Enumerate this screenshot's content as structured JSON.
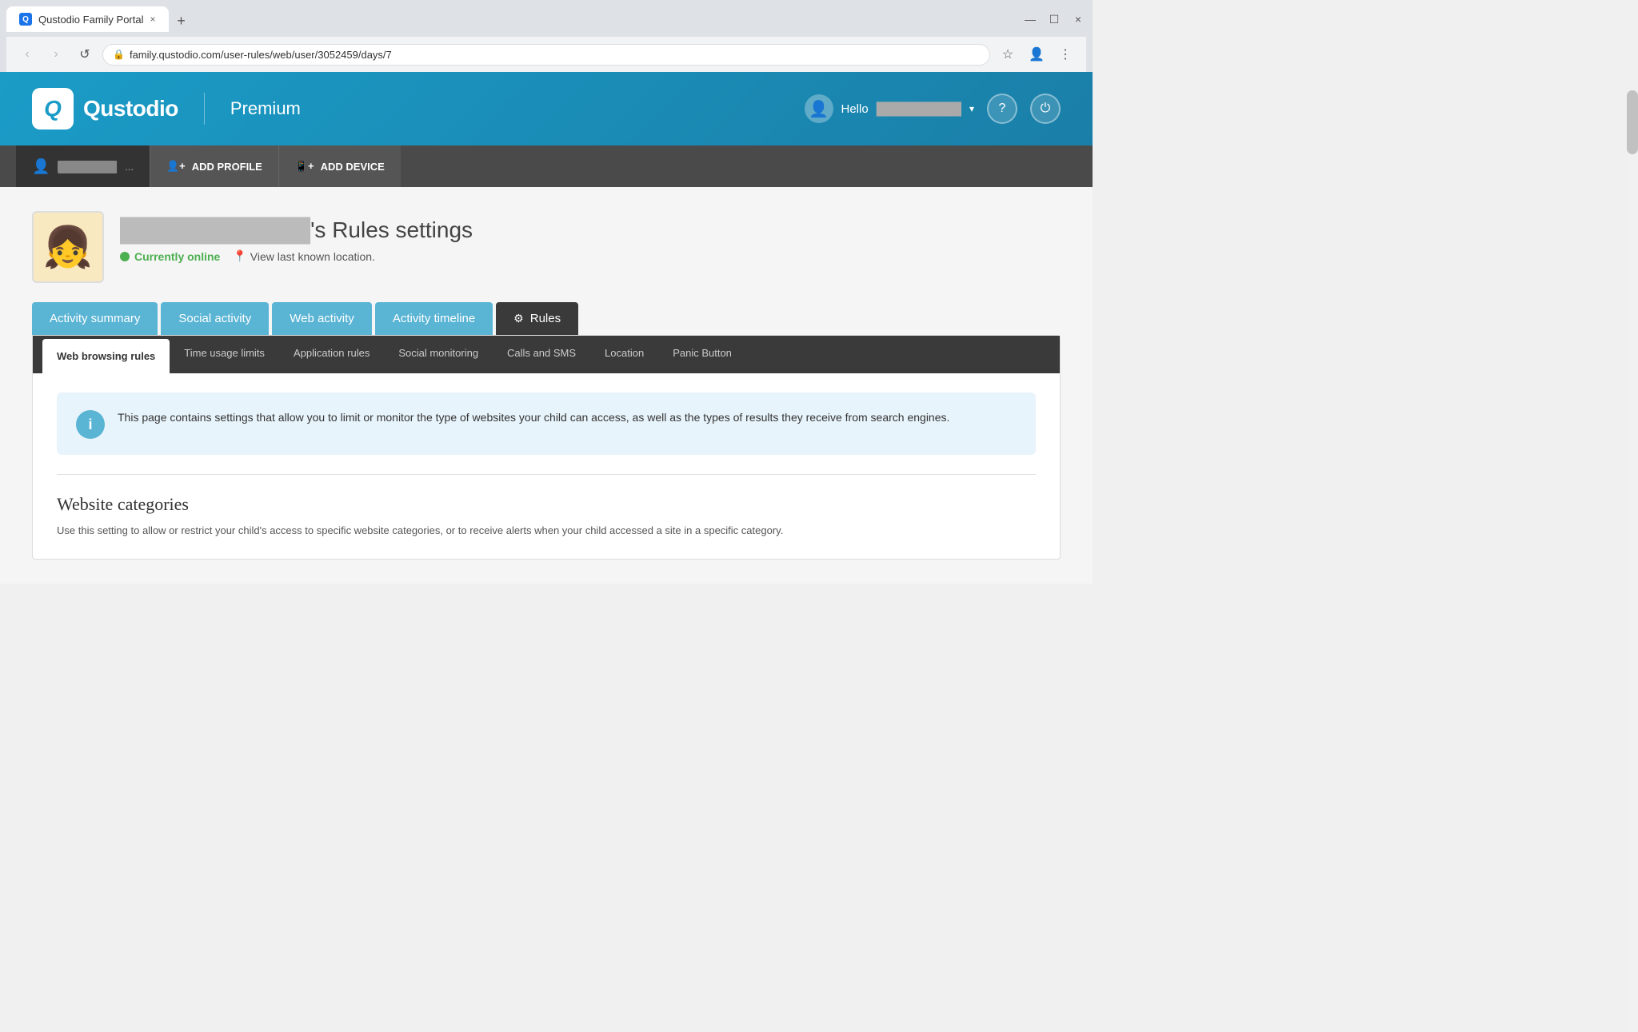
{
  "browser": {
    "tab_title": "Qustodio Family Portal",
    "tab_close": "×",
    "new_tab_btn": "+",
    "favicon_text": "Q",
    "nav": {
      "back": "‹",
      "forward": "›",
      "refresh": "↺"
    },
    "address": "family.qustodio.com/user-rules/web/user/3052459/days/7",
    "lock_icon": "🔒",
    "bookmark_icon": "☆",
    "account_icon": "👤",
    "more_icon": "⋮",
    "minimize": "—",
    "maximize": "☐",
    "close": "×"
  },
  "header": {
    "logo_letter": "Q",
    "logo_name": "Qustodio",
    "plan": "Premium",
    "hello": "Hello",
    "user_name": "██████████",
    "help_icon": "?",
    "power_icon": "⏻",
    "avatar_icon": "👤"
  },
  "profile_bar": {
    "profile_name": "████████",
    "more": "...",
    "add_profile_label": "ADD PROFILE",
    "add_device_label": "ADD DEVICE",
    "add_profile_icon": "👤+",
    "add_device_icon": "📱+"
  },
  "child": {
    "avatar_emoji": "👧",
    "name_blur": "████████████",
    "title_suffix": "'s Rules settings",
    "status": "Currently online",
    "location_link": "View last known location.",
    "pin": "📍"
  },
  "nav_tabs": [
    {
      "id": "activity-summary",
      "label": "Activity summary",
      "active": false
    },
    {
      "id": "social-activity",
      "label": "Social activity",
      "active": false
    },
    {
      "id": "web-activity",
      "label": "Web activity",
      "active": false
    },
    {
      "id": "activity-timeline",
      "label": "Activity timeline",
      "active": false
    },
    {
      "id": "rules",
      "label": "Rules",
      "active": true,
      "icon": "⚙"
    }
  ],
  "sub_tabs": [
    {
      "id": "web-browsing-rules",
      "label": "Web browsing rules",
      "active": true
    },
    {
      "id": "time-usage-limits",
      "label": "Time usage limits",
      "active": false
    },
    {
      "id": "application-rules",
      "label": "Application rules",
      "active": false
    },
    {
      "id": "social-monitoring",
      "label": "Social monitoring",
      "active": false
    },
    {
      "id": "calls-and-sms",
      "label": "Calls and SMS",
      "active": false
    },
    {
      "id": "location",
      "label": "Location",
      "active": false
    },
    {
      "id": "panic-button",
      "label": "Panic Button",
      "active": false
    }
  ],
  "info_box": {
    "icon": "i",
    "text": "This page contains settings that allow you to limit or monitor the type of websites your child can access, as well as the types of results they receive from search engines."
  },
  "website_categories": {
    "title": "Website categories",
    "description": "Use this setting to allow or restrict your child's access to specific website categories, or to receive alerts when your child accessed a site in a specific category."
  }
}
